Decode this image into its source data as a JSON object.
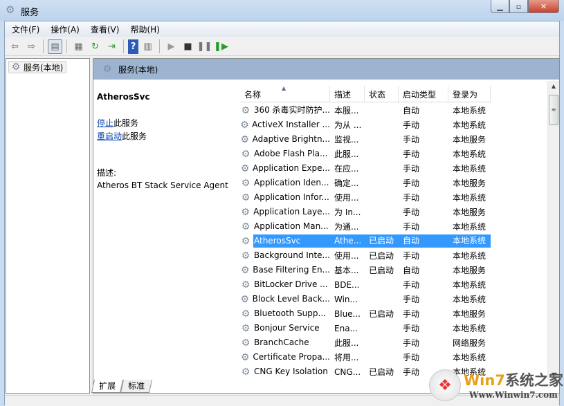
{
  "window": {
    "title": "服务",
    "min": "▁",
    "max": "▫",
    "close": "✕"
  },
  "menu": [
    "文件(F)",
    "操作(A)",
    "查看(V)",
    "帮助(H)"
  ],
  "tree": {
    "root": "服务(本地)"
  },
  "pane": {
    "header": "服务(本地)",
    "selected_name": "AtherosSvc",
    "stop_link": "停止",
    "stop_suffix": "此服务",
    "restart_link": "重启动",
    "restart_suffix": "此服务",
    "desc_label": "描述:",
    "desc_text": "Atheros BT Stack Service Agent"
  },
  "columns": [
    "名称",
    "描述",
    "状态",
    "启动类型",
    "登录为"
  ],
  "rows": [
    [
      "360 杀毒实时防护...",
      "本服...",
      "",
      "自动",
      "本地系统"
    ],
    [
      "ActiveX Installer ...",
      "为从 ...",
      "",
      "手动",
      "本地系统"
    ],
    [
      "Adaptive Brightn...",
      "监视...",
      "",
      "手动",
      "本地服务"
    ],
    [
      "Adobe Flash Pla...",
      "此服...",
      "",
      "手动",
      "本地系统"
    ],
    [
      "Application Expe...",
      "在应...",
      "",
      "手动",
      "本地系统"
    ],
    [
      "Application Iden...",
      "确定...",
      "",
      "手动",
      "本地服务"
    ],
    [
      "Application Infor...",
      "使用...",
      "",
      "手动",
      "本地系统"
    ],
    [
      "Application Laye...",
      "为 In...",
      "",
      "手动",
      "本地服务"
    ],
    [
      "Application Man...",
      "为通...",
      "",
      "手动",
      "本地系统"
    ],
    [
      "AtherosSvc",
      "Athe...",
      "已启动",
      "自动",
      "本地系统"
    ],
    [
      "Background Inte...",
      "使用...",
      "已启动",
      "手动",
      "本地系统"
    ],
    [
      "Base Filtering En...",
      "基本...",
      "已启动",
      "自动",
      "本地服务"
    ],
    [
      "BitLocker Drive ...",
      "BDE...",
      "",
      "手动",
      "本地系统"
    ],
    [
      "Block Level Back...",
      "Win...",
      "",
      "手动",
      "本地系统"
    ],
    [
      "Bluetooth Supp...",
      "Blue...",
      "已启动",
      "手动",
      "本地服务"
    ],
    [
      "Bonjour Service",
      "Ena...",
      "",
      "手动",
      "本地系统"
    ],
    [
      "BranchCache",
      "此服...",
      "",
      "手动",
      "网络服务"
    ],
    [
      "Certificate Propa...",
      "将用...",
      "",
      "手动",
      "本地系统"
    ],
    [
      "CNG Key Isolation",
      "CNG...",
      "已启动",
      "手动",
      "本地系统"
    ]
  ],
  "selected_index": 9,
  "tabs": [
    "扩展",
    "标准"
  ],
  "watermark": {
    "brand_a": "Win7",
    "brand_b": "系统之家",
    "url": "Www.Winwin7.com"
  },
  "colors": {
    "selection": "#3399ff",
    "header": "#9cb4cf",
    "link": "#0645ad"
  }
}
